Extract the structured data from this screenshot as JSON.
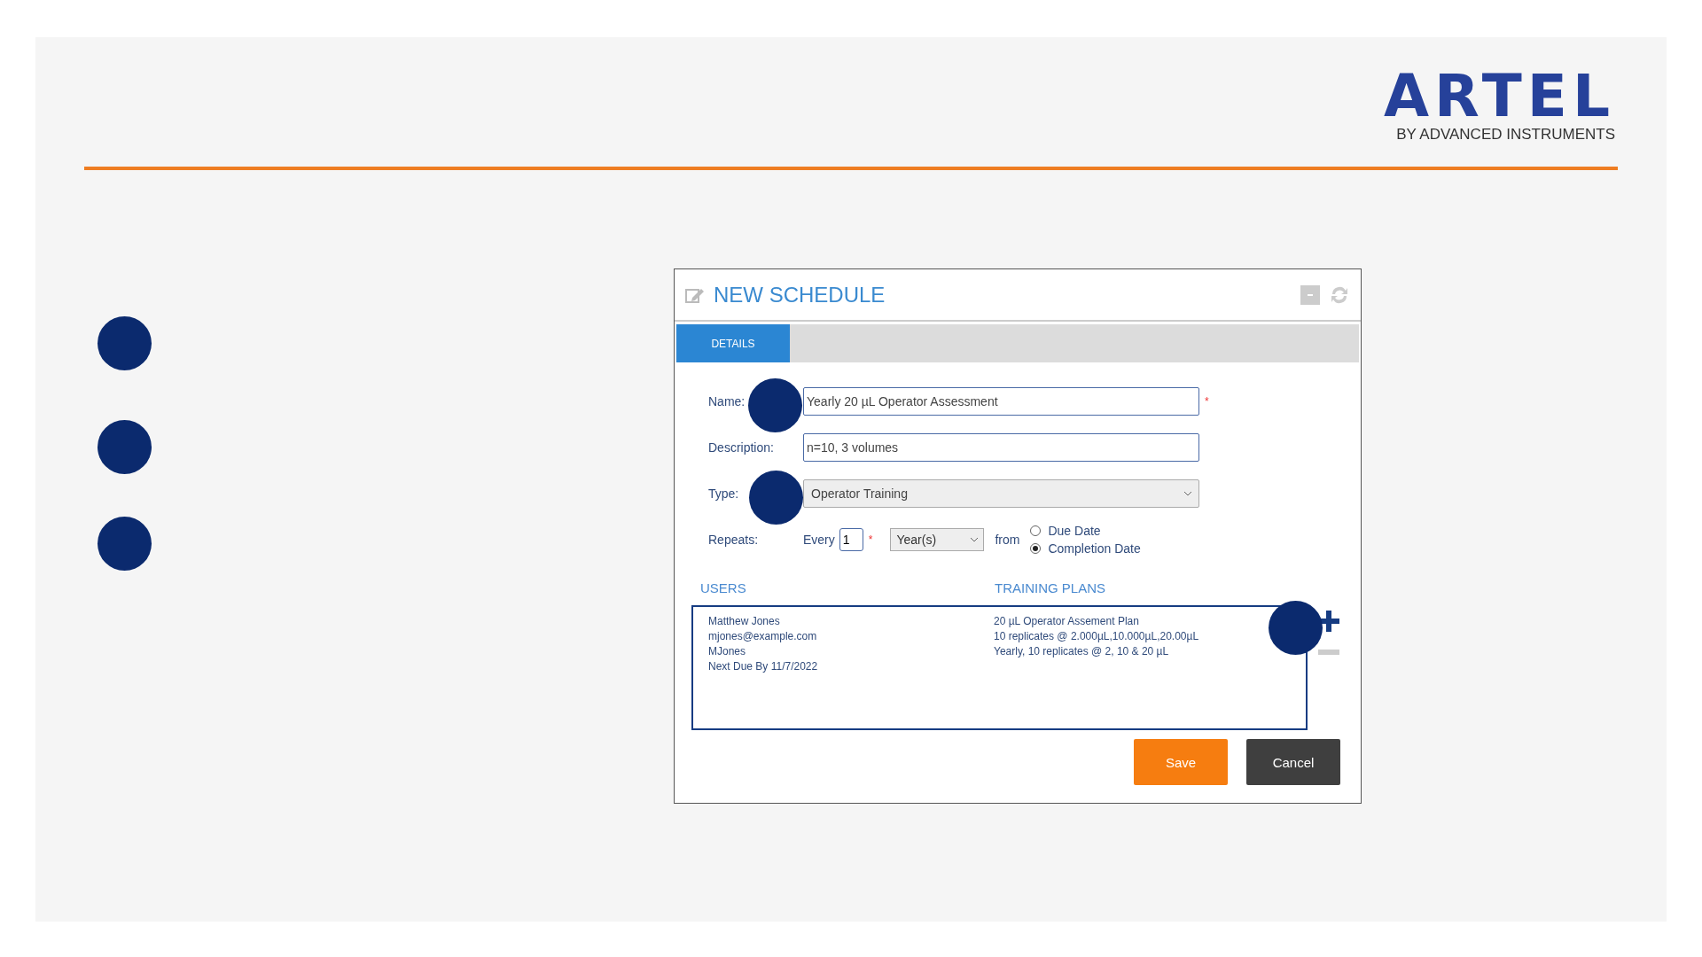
{
  "logo": {
    "wordmark": "ARTEL",
    "tagline": "BY ADVANCED INSTRUMENTS"
  },
  "dialog": {
    "title": "NEW SCHEDULE",
    "tabs": [
      {
        "label": "DETAILS",
        "selected": true
      }
    ],
    "fields": [
      {
        "kind": "text",
        "label": "Name:",
        "value": "Yearly 20 µL Operator Assessment",
        "required_mark": "*"
      },
      {
        "kind": "textarea",
        "label": "Description:",
        "value": "n=10, 3 volumes"
      },
      {
        "kind": "select",
        "label": "Type:",
        "value": "Operator Training"
      }
    ],
    "repeats": {
      "label": "Repeats:",
      "every_label": "Every",
      "every_value": "1",
      "required_mark": "*",
      "unit": "Year(s)",
      "from_label": "from",
      "options": [
        {
          "label": "Due Date",
          "selected": false
        },
        {
          "label": "Completion Date",
          "selected": true
        }
      ]
    },
    "users_heading": "USERS",
    "plans_heading": "TRAINING PLANS",
    "entries": [
      {
        "user": [
          "Matthew Jones",
          "mjones@example.com",
          "MJones",
          "Next Due By  11/7/2022"
        ],
        "plan": [
          "20 µL Operator Assement Plan",
          "10 replicates @ 2.000µL,10.000µL,20.00µL",
          "Yearly, 10 replicates @ 2, 10 & 20 µL"
        ]
      }
    ],
    "buttons": [
      {
        "label": "Save",
        "kind": "primary"
      },
      {
        "label": "Cancel",
        "kind": "secondary"
      }
    ]
  }
}
